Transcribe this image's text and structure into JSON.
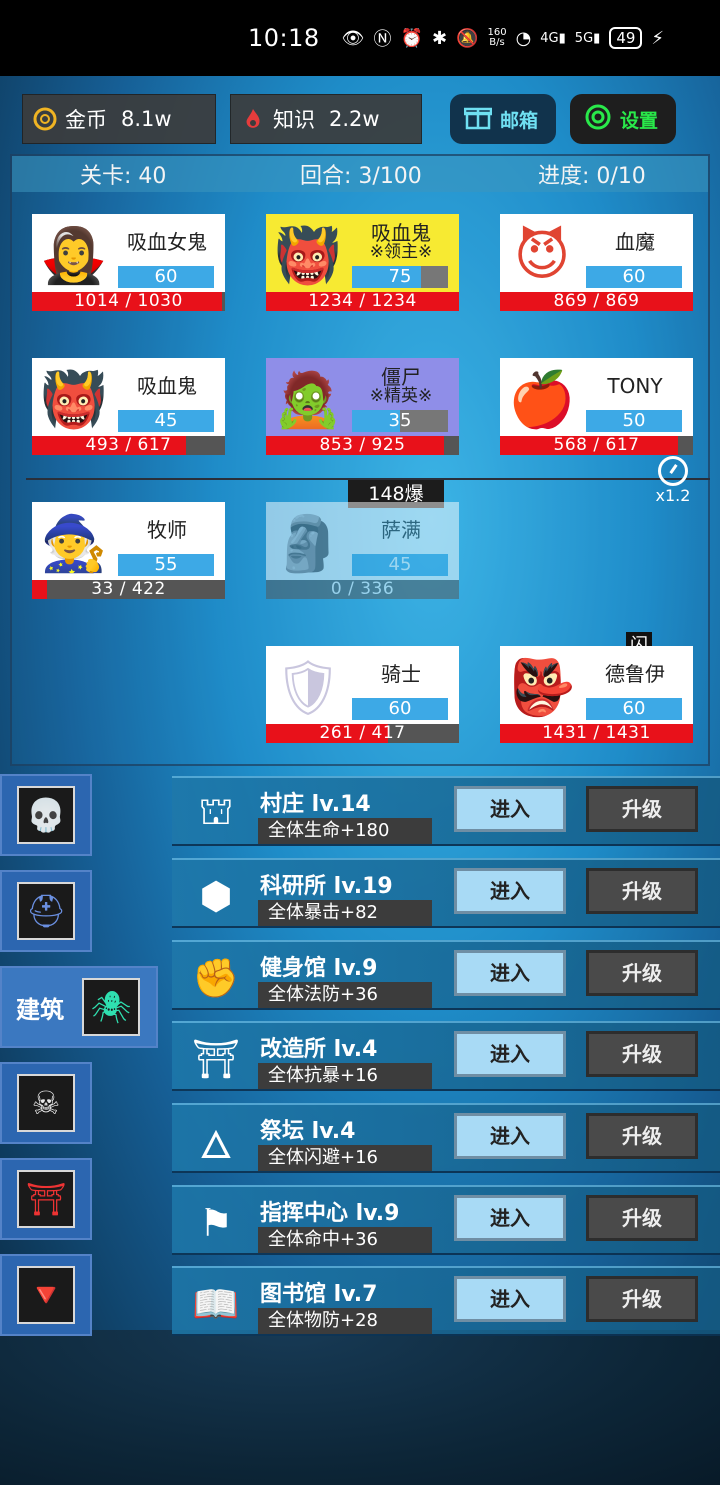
{
  "status_bar": {
    "time": "10:18",
    "net_speed_top": "160",
    "net_speed_bottom": "B/s",
    "signal1": "4G",
    "signal2": "5G",
    "battery": "49"
  },
  "resources": {
    "gold_label": "金币",
    "gold_value": "8.1w",
    "knowledge_label": "知识",
    "knowledge_value": "2.2w"
  },
  "top_buttons": {
    "mail": "邮箱",
    "settings": "设置"
  },
  "stage": {
    "level": "关卡: 40",
    "round": "回合: 3/100",
    "progress": "进度: 0/10"
  },
  "speed": "x1.2",
  "hit_badge": "148爆",
  "flash_badge": "闪",
  "enemies": [
    {
      "name": "吸血女鬼",
      "sub": "",
      "level": "60",
      "level_fill": 1.0,
      "hp": "1014 / 1030",
      "hp_frac": 0.984,
      "portrait": "purple-vampire-woman",
      "glyph": "🧛‍♀️"
    },
    {
      "name": "吸血鬼",
      "sub": "※领主※",
      "level": "75",
      "level_fill": 0.72,
      "hp": "1234 / 1234",
      "hp_frac": 1.0,
      "portrait": "red-oni-mask",
      "glyph": "👹"
    },
    {
      "name": "血魔",
      "sub": "",
      "level": "60",
      "level_fill": 1.0,
      "hp": "869 / 869",
      "hp_frac": 1.0,
      "portrait": "red-devil",
      "glyph": "😈"
    },
    {
      "name": "吸血鬼",
      "sub": "",
      "level": "45",
      "level_fill": 1.0,
      "hp": "493 / 617",
      "hp_frac": 0.8,
      "portrait": "red-oni-mask",
      "glyph": "👹"
    },
    {
      "name": "僵尸",
      "sub": "※精英※",
      "level": "35",
      "level_fill": 0.5,
      "hp": "853 / 925",
      "hp_frac": 0.92,
      "portrait": "zombie",
      "glyph": "🧟"
    },
    {
      "name": "TONY",
      "sub": "",
      "level": "50",
      "level_fill": 1.0,
      "hp": "568 / 617",
      "hp_frac": 0.92,
      "portrait": "poison-apple",
      "glyph": "🍎"
    }
  ],
  "heroes": [
    {
      "name": "牧师",
      "level": "55",
      "level_fill": 1.0,
      "hp": "33 / 422",
      "hp_frac": 0.08,
      "portrait": "wizard",
      "glyph": "🧙"
    },
    {
      "name": "萨满",
      "level": "45",
      "level_fill": 1.0,
      "hp": "0 / 336",
      "hp_frac": 0.0,
      "portrait": "shaman",
      "glyph": "🗿"
    },
    {
      "name": "骑士",
      "level": "60",
      "level_fill": 1.0,
      "hp": "261 / 417",
      "hp_frac": 0.63,
      "portrait": "knight",
      "glyph": "🛡"
    },
    {
      "name": "德鲁伊",
      "level": "60",
      "level_fill": 1.0,
      "hp": "1431 / 1431",
      "hp_frac": 1.0,
      "portrait": "blue-ogre",
      "glyph": "👺"
    }
  ],
  "tabs": [
    {
      "id": "hero",
      "icon": "skull-frog-icon",
      "glyph": "💀"
    },
    {
      "id": "equip",
      "icon": "helmet-icon",
      "glyph": "⛑"
    },
    {
      "id": "building",
      "label": "建筑",
      "icon": "spider-shield-icon",
      "glyph": "🕷"
    },
    {
      "id": "skill",
      "icon": "skull-scroll-icon",
      "glyph": "☠"
    },
    {
      "id": "gate",
      "icon": "torii-gate-icon",
      "glyph": "⛩"
    },
    {
      "id": "amulet",
      "icon": "necklace-icon",
      "glyph": "🔻"
    }
  ],
  "buildings": [
    {
      "name": "村庄 lv.14",
      "bonus": "全体生命+180",
      "icon": "arch-gate-icon",
      "glyph": "⛫"
    },
    {
      "name": "科研所 lv.19",
      "bonus": "全体暴击+82",
      "icon": "cube-icon",
      "glyph": "⬢"
    },
    {
      "name": "健身馆 lv.9",
      "bonus": "全体法防+36",
      "icon": "fist-icon",
      "glyph": "✊"
    },
    {
      "name": "改造所 lv.4",
      "bonus": "全体抗暴+16",
      "icon": "pillar-icon",
      "glyph": "⛩"
    },
    {
      "name": "祭坛 lv.4",
      "bonus": "全体闪避+16",
      "icon": "altar-icon",
      "glyph": "🜂"
    },
    {
      "name": "指挥中心 lv.9",
      "bonus": "全体命中+36",
      "icon": "banner-icon",
      "glyph": "⚑"
    },
    {
      "name": "图书馆 lv.7",
      "bonus": "全体物防+28",
      "icon": "book-icon",
      "glyph": "📖"
    }
  ],
  "building_buttons": {
    "enter": "进入",
    "upgrade": "升级"
  }
}
